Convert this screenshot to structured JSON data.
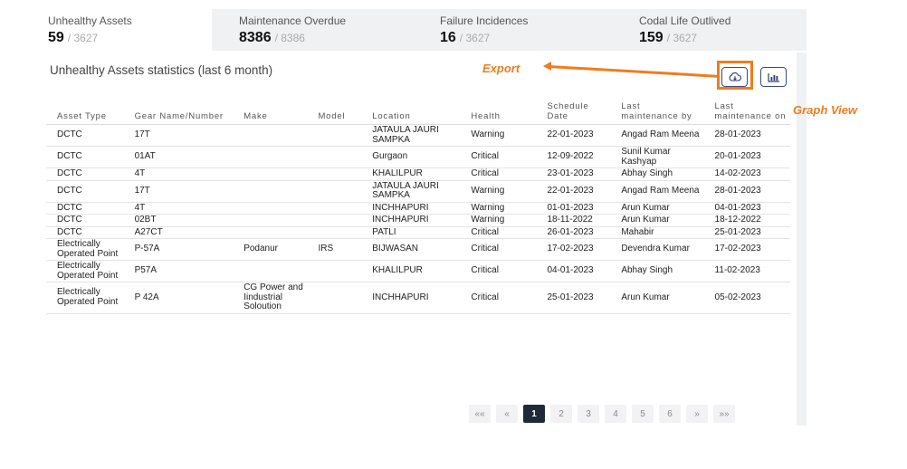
{
  "stats": [
    {
      "label": "Unhealthy Assets",
      "value": "59",
      "total": "/ 3627"
    },
    {
      "label": "Maintenance Overdue",
      "value": "8386",
      "total": "/ 8386"
    },
    {
      "label": "Failure Incidences",
      "value": "16",
      "total": "/ 3627"
    },
    {
      "label": "Codal Life Outlived",
      "value": "159",
      "total": "/ 3627"
    }
  ],
  "panel": {
    "title": "Unhealthy Assets statistics (last 6 month)"
  },
  "annotations": {
    "export": "Export",
    "graph": "Graph View"
  },
  "icons": {
    "export": "cloud-download-icon",
    "graph": "bar-chart-icon"
  },
  "colors": {
    "accent": "#f07c1e",
    "warning": "#e8a317",
    "critical": "#e0241d",
    "active_page": "#1e2a38"
  },
  "table": {
    "headers": [
      "Asset Type",
      "Gear Name/Number",
      "Make",
      "Model",
      "Location",
      "Health",
      "Schedule Date",
      "Last maintenance by",
      "Last maintenance on"
    ],
    "rows": [
      [
        "DCTC",
        "17T",
        "",
        "",
        "JATAULA JAURI SAMPKA",
        "Warning",
        "22-01-2023",
        "Angad Ram Meena",
        "28-01-2023"
      ],
      [
        "DCTC",
        "01AT",
        "",
        "",
        "Gurgaon",
        "Critical",
        "12-09-2022",
        "Sunil Kumar Kashyap",
        "20-01-2023"
      ],
      [
        "DCTC",
        "4T",
        "",
        "",
        "KHALILPUR",
        "Critical",
        "23-01-2023",
        "Abhay Singh",
        "14-02-2023"
      ],
      [
        "DCTC",
        "17T",
        "",
        "",
        "JATAULA JAURI SAMPKA",
        "Warning",
        "22-01-2023",
        "Angad Ram Meena",
        "28-01-2023"
      ],
      [
        "DCTC",
        "4T",
        "",
        "",
        "INCHHAPURI",
        "Warning",
        "01-01-2023",
        "Arun Kumar",
        "04-01-2023"
      ],
      [
        "DCTC",
        "02BT",
        "",
        "",
        "INCHHAPURI",
        "Warning",
        "18-11-2022",
        "Arun Kumar",
        "18-12-2022"
      ],
      [
        "DCTC",
        "A27CT",
        "",
        "",
        "PATLI",
        "Critical",
        "26-01-2023",
        "Mahabir",
        "25-01-2023"
      ],
      [
        "Electrically Operated Point",
        "P-57A",
        "Podanur",
        "IRS",
        "BIJWASAN",
        "Critical",
        "17-02-2023",
        "Devendra Kumar",
        "17-02-2023"
      ],
      [
        "Electrically Operated Point",
        "P57A",
        "",
        "",
        "KHALILPUR",
        "Critical",
        "04-01-2023",
        "Abhay Singh",
        "11-02-2023"
      ],
      [
        "Electrically Operated Point",
        "P 42A",
        "CG Power and Iindustrial Soloution",
        "",
        "INCHHAPURI",
        "Critical",
        "25-01-2023",
        "Arun Kumar",
        "05-02-2023"
      ]
    ]
  },
  "pagination": {
    "items": [
      "««",
      "«",
      "1",
      "2",
      "3",
      "4",
      "5",
      "6",
      "»",
      "»»"
    ],
    "current": "1"
  }
}
